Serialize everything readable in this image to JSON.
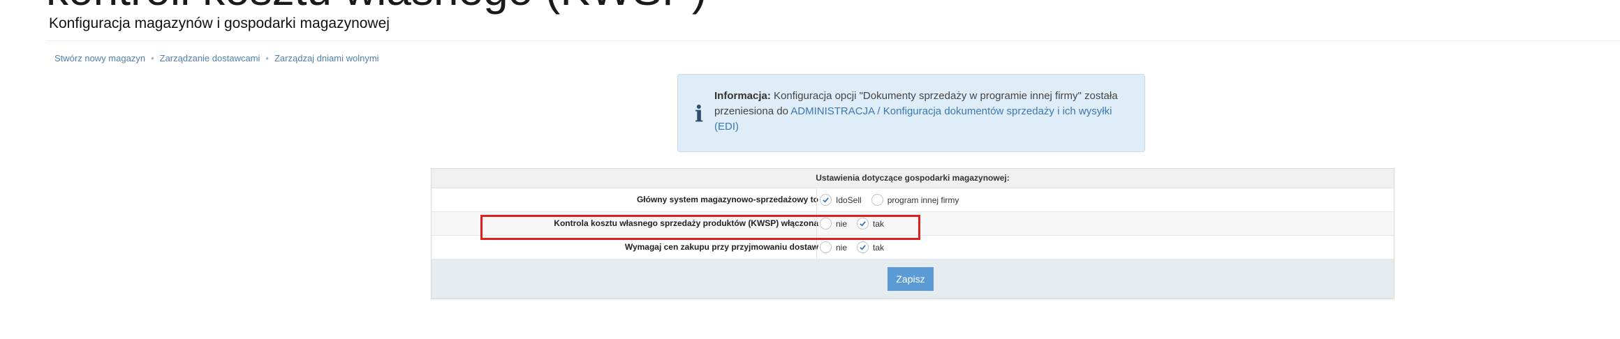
{
  "overlay_title": "kontroli kosztu własnego (KWSP)",
  "page_title": "Konfiguracja magazynów i gospodarki magazynowej",
  "links": [
    "Stwórz nowy magazyn",
    "Zarządzanie dostawcami",
    "Zarządzaj dniami wolnymi"
  ],
  "link_separator": "•",
  "info": {
    "bold": "Informacja:",
    "text_before_link": " Konfiguracja opcji \"Dokumenty sprzedaży w programie innej firmy\" została przeniesiona do ",
    "link": "ADMINISTRACJA / Konfiguracja dokumentów sprzedaży i ich wysyłki (EDI)"
  },
  "settings": {
    "header": "Ustawienia dotyczące gospodarki magazynowej:",
    "rows": [
      {
        "label": "Główny system magazynowo-sprzedażowy to",
        "options": [
          "IdoSell",
          "program innej firmy"
        ],
        "selected": 0
      },
      {
        "label": "Kontrola kosztu własnego sprzedaży produktów (KWSP) włączona",
        "options": [
          "nie",
          "tak"
        ],
        "selected": 1
      },
      {
        "label": "Wymagaj cen zakupu przy przyjmowaniu dostaw",
        "options": [
          "nie",
          "tak"
        ],
        "selected": 1
      }
    ],
    "save_label": "Zapisz"
  },
  "colors": {
    "accent": "#5b9bd5",
    "highlight": "#e02020",
    "info_bg": "#deedf8"
  },
  "icons": [
    "info-icon",
    "check-icon"
  ]
}
